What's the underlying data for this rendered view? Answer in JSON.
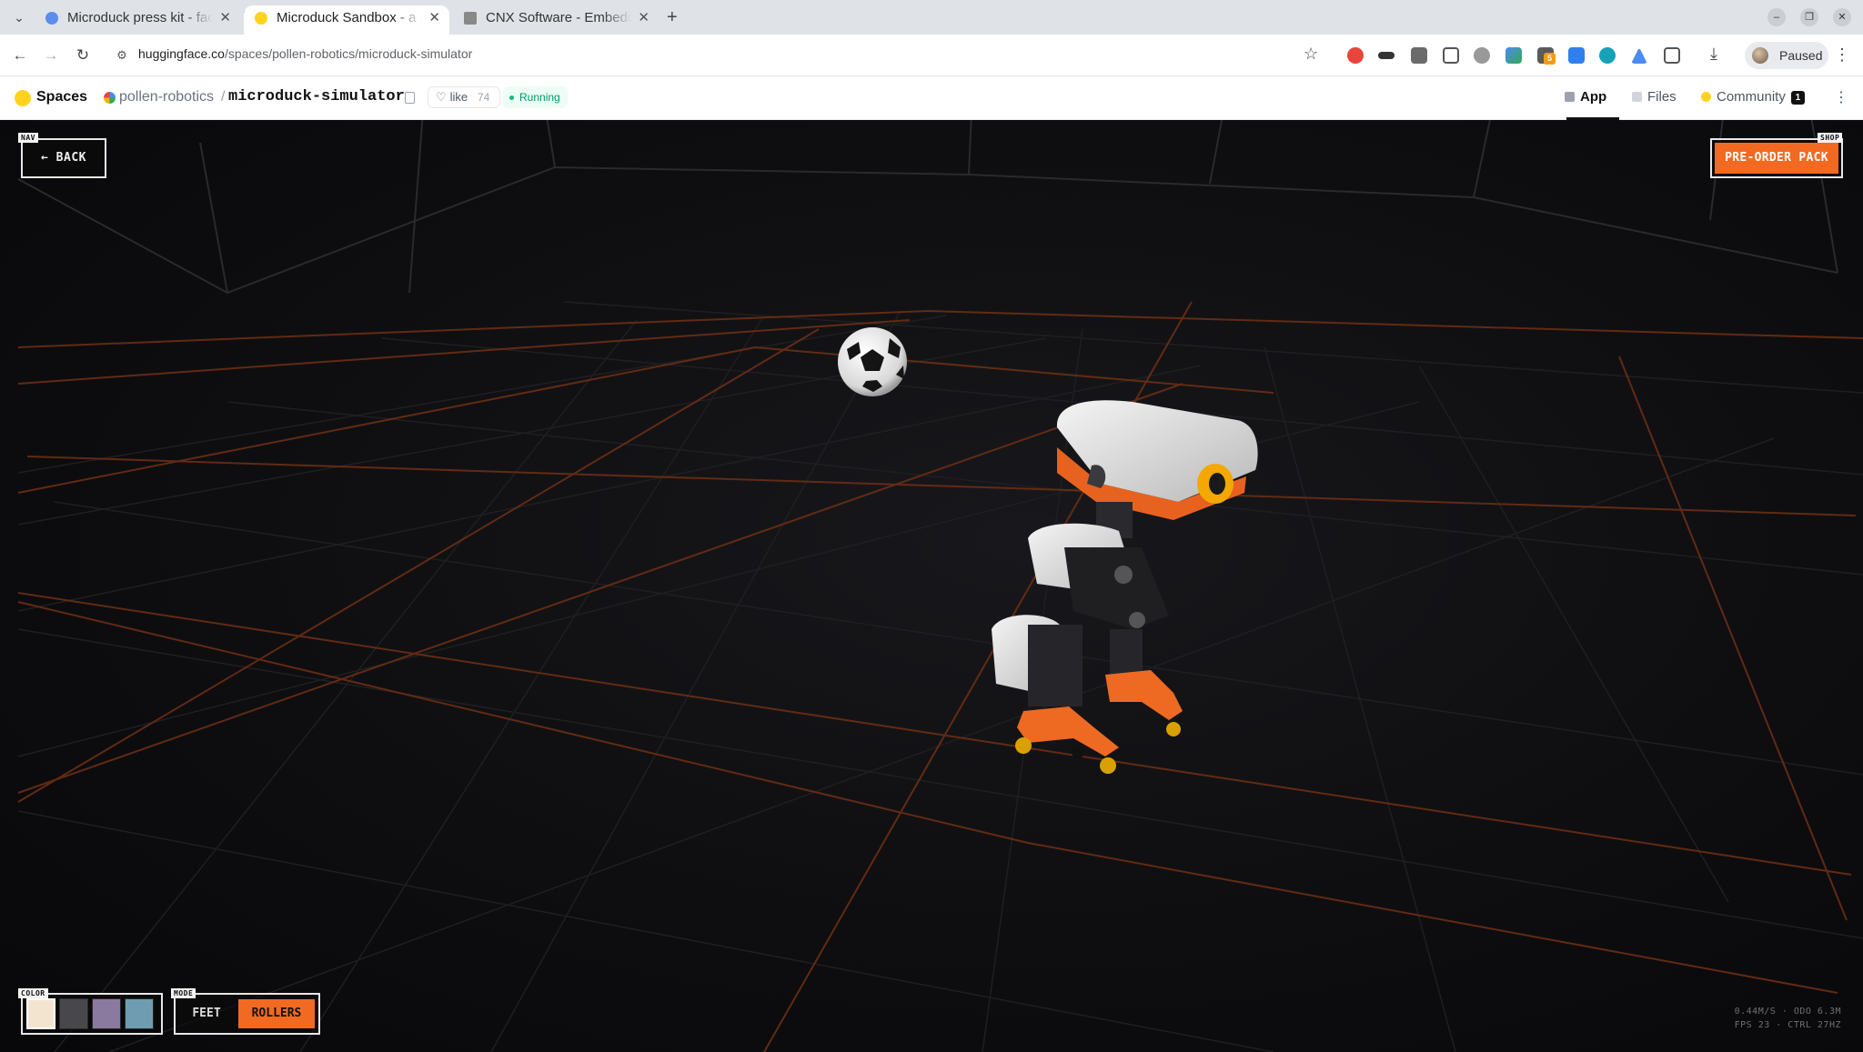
{
  "browser": {
    "tabs": [
      {
        "title": "Microduck press kit - facto",
        "favicon_color": "#5b8def",
        "active": false
      },
      {
        "title": "Microduck Sandbox - a Hugg",
        "favicon_color": "#ffd21e",
        "active": true
      },
      {
        "title": "CNX Software - Embedded",
        "favicon_color": "#888888",
        "active": false
      }
    ],
    "url_domain": "huggingface.co",
    "url_path": "/spaces/pollen-robotics/microduck-simulator",
    "profile_label": "Paused",
    "extension_badge": "5"
  },
  "hf": {
    "section": "Spaces",
    "org": "pollen-robotics",
    "repo": "microduck-simulator",
    "like_label": "like",
    "like_count": "74",
    "status": "Running",
    "tabs": {
      "app": "App",
      "files": "Files",
      "community": "Community",
      "community_count": "1"
    }
  },
  "app": {
    "nav_tag": "NAV",
    "back_label": "← BACK",
    "shop_tag": "SHOP",
    "preorder_label": "PRE-ORDER PACK",
    "color_tag": "COLOR",
    "swatches": [
      "#f3e4cf",
      "#48484c",
      "#8a7aa0",
      "#6f9cb0"
    ],
    "mode_tag": "MODE",
    "mode_feet": "FEET",
    "mode_rollers": "ROLLERS",
    "mode_selected": "ROLLERS",
    "stats_line1": "0.44M/S · ODO 6.3M",
    "stats_line2": "FPS 23 · CTRL 27HZ",
    "accent_color": "#f26a21"
  }
}
